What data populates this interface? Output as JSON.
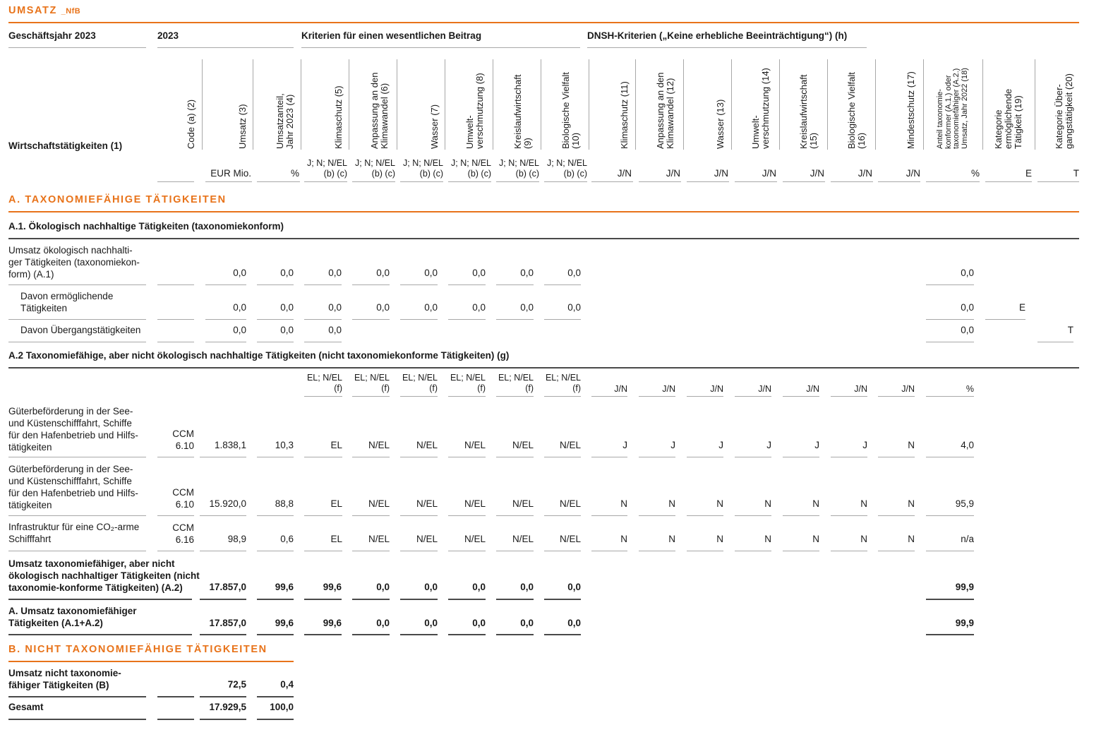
{
  "title": "UMSATZ",
  "title_suffix": "_NfB",
  "header": {
    "fy_label": "Geschäftsjahr 2023",
    "year": "2023",
    "crit_label": "Kriterien für einen wesentlichen Beitrag",
    "dnsh_label": "DNSH-Kriterien („Keine erhebliche Beeinträchtigung“) (h)",
    "activity_label": "Wirtschaftstätigkeiten (1)",
    "col2": "Code (a) (2)",
    "col3": "Umsatz (3)",
    "col4a": "Umsatzanteil,",
    "col4b": "Jahr 2023 (4)",
    "col5": "Klimaschutz (5)",
    "col6a": "Anpassung an den",
    "col6b": "Klimawandel (6)",
    "col7": "Wasser (7)",
    "col8a": "Umwelt-",
    "col8b": "verschmutzung (8)",
    "col9a": "Kreislaufwirtschaft",
    "col9b": "(9)",
    "col10a": "Biologische Vielfalt",
    "col10b": "(10)",
    "col11": "Klimaschutz (11)",
    "col12a": "Anpassung an den",
    "col12b": "Klimawandel (12)",
    "col13": "Wasser (13)",
    "col14a": "Umwelt-",
    "col14b": "verschmutzung (14)",
    "col15a": "Kreislaufwirtschaft",
    "col15b": "(15)",
    "col16a": "Biologische Vielfalt",
    "col16b": "(16)",
    "col17": "Mindestschutz (17)",
    "col18a": "Anteil taxonomie-",
    "col18b": "konformer (A.1.) oder",
    "col18c": "taxonomiefähiger (A.2.)",
    "col18d": "Umsatz, Jahr 2022 (18)",
    "col19a": "Kategorie",
    "col19b": "ermöglichende",
    "col19c": "Tätigkeit (19)",
    "col20a": "Kategorie Über-",
    "col20b": "gangstätigkeit (20)",
    "unit_eur": "EUR Mio.",
    "unit_pct": "%",
    "unit_jn_a": "J; N; N/EL",
    "unit_jn_b": "(b) (c)",
    "unit_jn": "J/N",
    "unit_pct2": "%",
    "unit_e": "E",
    "unit_t": "T"
  },
  "sectionA": "A. TAXONOMIEFÄHIGE TÄTIGKEITEN",
  "a1": {
    "heading": "A.1. Ökologisch nachhaltige Tätigkeiten (taxonomiekonform)",
    "row1_l1": "Umsatz ökologisch nachhalti-",
    "row1_l2": "ger Tätigkeiten (taxonomiekon-",
    "row1_l3": "form) (A.1)",
    "row2_l1": "Davon ermöglichende",
    "row2_l2": "Tätigkeiten",
    "row3": "Davon Übergangstätigkeiten",
    "zero": "0,0",
    "e": "E",
    "t": "T"
  },
  "a2": {
    "heading": "A.2 Taxonomiefähige, aber nicht ökologisch nachhaltige Tätigkeiten (nicht taxonomiekonforme Tätigkeiten) (g)",
    "unit_el_a": "EL; N/EL",
    "unit_el_b": "(f)",
    "unit_jn": "J/N",
    "unit_pct": "%",
    "rows": [
      {
        "lines": [
          "Güterbeförderung in der See-",
          "und Küstenschifffahrt, Schiffe",
          "für den Hafenbetrieb und Hilfs-",
          "tätigkeiten"
        ],
        "code1": "CCM",
        "code2": "6.10",
        "umsatz": "1.838,1",
        "anteil": "10,3",
        "c5": "EL",
        "c6": "N/EL",
        "c7": "N/EL",
        "c8": "N/EL",
        "c9": "N/EL",
        "c10": "N/EL",
        "d11": "J",
        "d12": "J",
        "d13": "J",
        "d14": "J",
        "d15": "J",
        "d16": "J",
        "d17": "N",
        "prev": "4,0"
      },
      {
        "lines": [
          "Güterbeförderung in der See-",
          "und Küstenschifffahrt, Schiffe",
          "für den Hafenbetrieb und Hilfs-",
          "tätigkeiten"
        ],
        "code1": "CCM",
        "code2": "6.10",
        "umsatz": "15.920,0",
        "anteil": "88,8",
        "c5": "EL",
        "c6": "N/EL",
        "c7": "N/EL",
        "c8": "N/EL",
        "c9": "N/EL",
        "c10": "N/EL",
        "d11": "N",
        "d12": "N",
        "d13": "N",
        "d14": "N",
        "d15": "N",
        "d16": "N",
        "d17": "N",
        "prev": "95,9"
      },
      {
        "lines": [
          "Infrastruktur für eine CO₂-arme",
          "Schifffahrt"
        ],
        "code1": "CCM",
        "code2": "6.16",
        "umsatz": "98,9",
        "anteil": "0,6",
        "c5": "EL",
        "c6": "N/EL",
        "c7": "N/EL",
        "c8": "N/EL",
        "c9": "N/EL",
        "c10": "N/EL",
        "d11": "N",
        "d12": "N",
        "d13": "N",
        "d14": "N",
        "d15": "N",
        "d16": "N",
        "d17": "N",
        "prev": "n/a"
      }
    ],
    "total_l1": "Umsatz taxonomiefähiger, aber nicht",
    "total_l2": "ökologisch nachhaltiger Tätigkeiten (nicht",
    "total_l3": "taxonomie-konforme Tätigkeiten) (A.2)",
    "total_umsatz": "17.857,0",
    "total_anteil": "99,6",
    "total_c5": "99,6",
    "total_c6": "0,0",
    "total_c7": "0,0",
    "total_c8": "0,0",
    "total_c9": "0,0",
    "total_c10": "0,0",
    "total_prev": "99,9"
  },
  "atotal": {
    "l1": "A. Umsatz taxonomiefähiger",
    "l2": "Tätigkeiten (A.1+A.2)",
    "umsatz": "17.857,0",
    "anteil": "99,6",
    "c5": "99,6",
    "c6": "0,0",
    "c7": "0,0",
    "c8": "0,0",
    "c9": "0,0",
    "c10": "0,0",
    "prev": "99,9"
  },
  "sectionB": "B. NICHT TAXONOMIEFÄHIGE TÄTIGKEITEN",
  "b": {
    "l1": "Umsatz nicht taxonomie-",
    "l2": "fähiger Tätigkeiten (B)",
    "umsatz": "72,5",
    "anteil": "0,4",
    "gesamt": "Gesamt",
    "gesamt_umsatz": "17.929,5",
    "gesamt_anteil": "100,0"
  }
}
